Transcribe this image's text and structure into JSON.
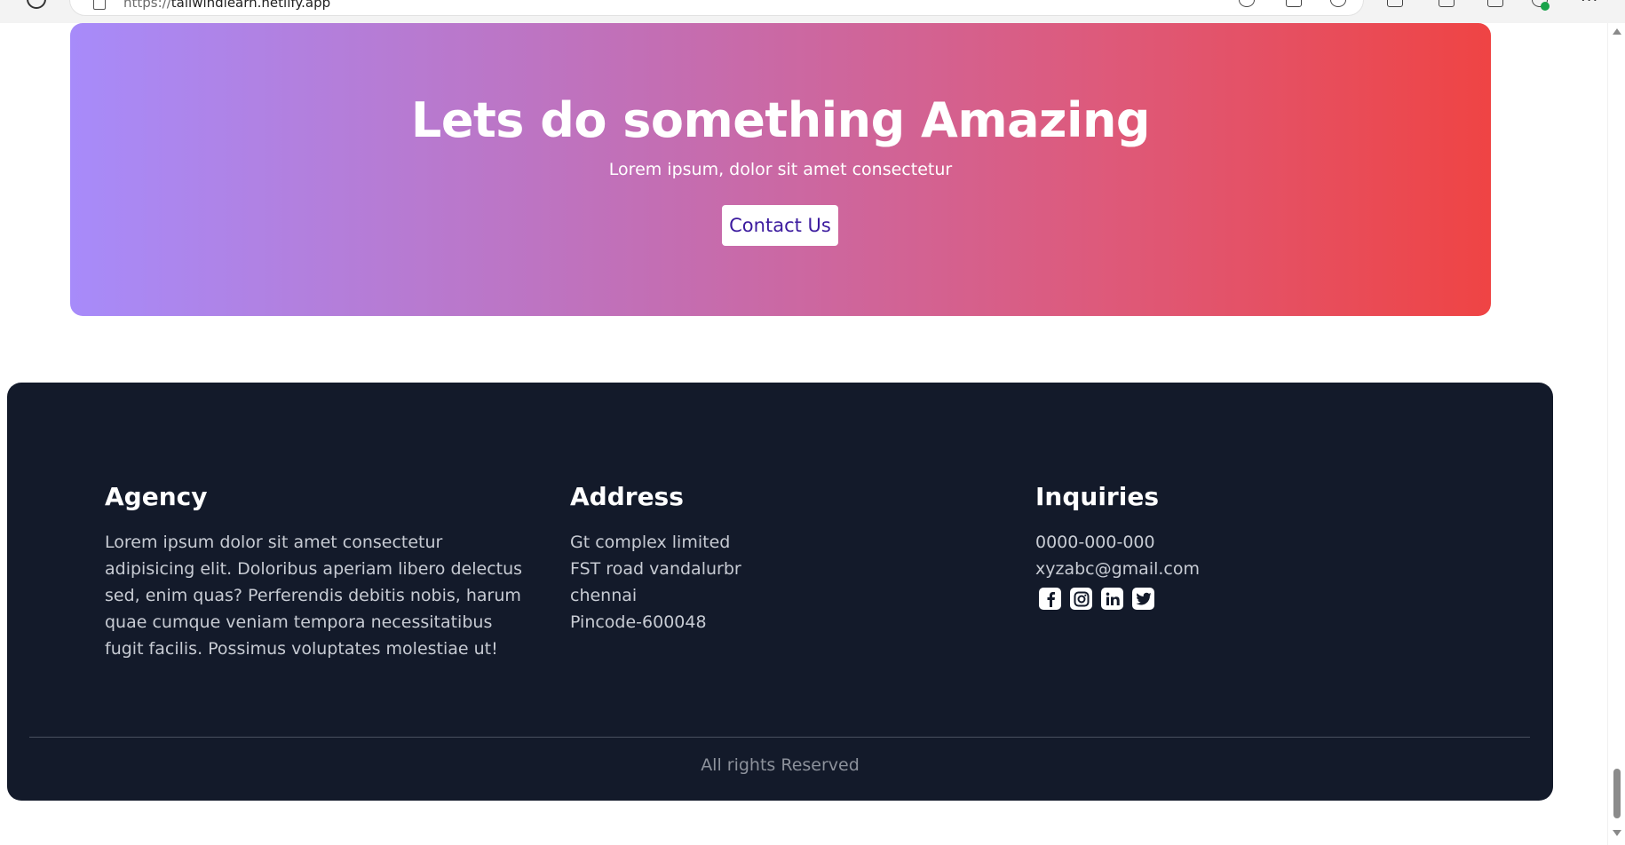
{
  "browser": {
    "url_scheme": "https://",
    "url_host": "tailwindlearn.netlify.app"
  },
  "cta": {
    "title": "Lets do something Amazing",
    "subtitle": "Lorem ipsum, dolor sit amet consectetur",
    "button_label": "Contact Us",
    "gradient_start": "#a78bfa",
    "gradient_end": "#ef4444"
  },
  "footer": {
    "background": "#131a2a",
    "agency": {
      "heading": "Agency",
      "text": "Lorem ipsum dolor sit amet consectetur adipisicing elit. Doloribus aperiam libero delectus sed, enim quas? Perferendis debitis nobis, harum quae cumque veniam tempora necessitatibus fugit facilis. Possimus voluptates molestiae ut!"
    },
    "address": {
      "heading": "Address",
      "lines": [
        "Gt complex limited",
        "FST road vandalurbr",
        "chennai",
        "Pincode-600048"
      ]
    },
    "inquiries": {
      "heading": "Inquiries",
      "phone": "0000-000-000",
      "email": "xyzabc@gmail.com",
      "social": [
        "facebook-icon",
        "instagram-icon",
        "linkedin-icon",
        "twitter-icon"
      ]
    },
    "copyright": "All rights Reserved"
  }
}
